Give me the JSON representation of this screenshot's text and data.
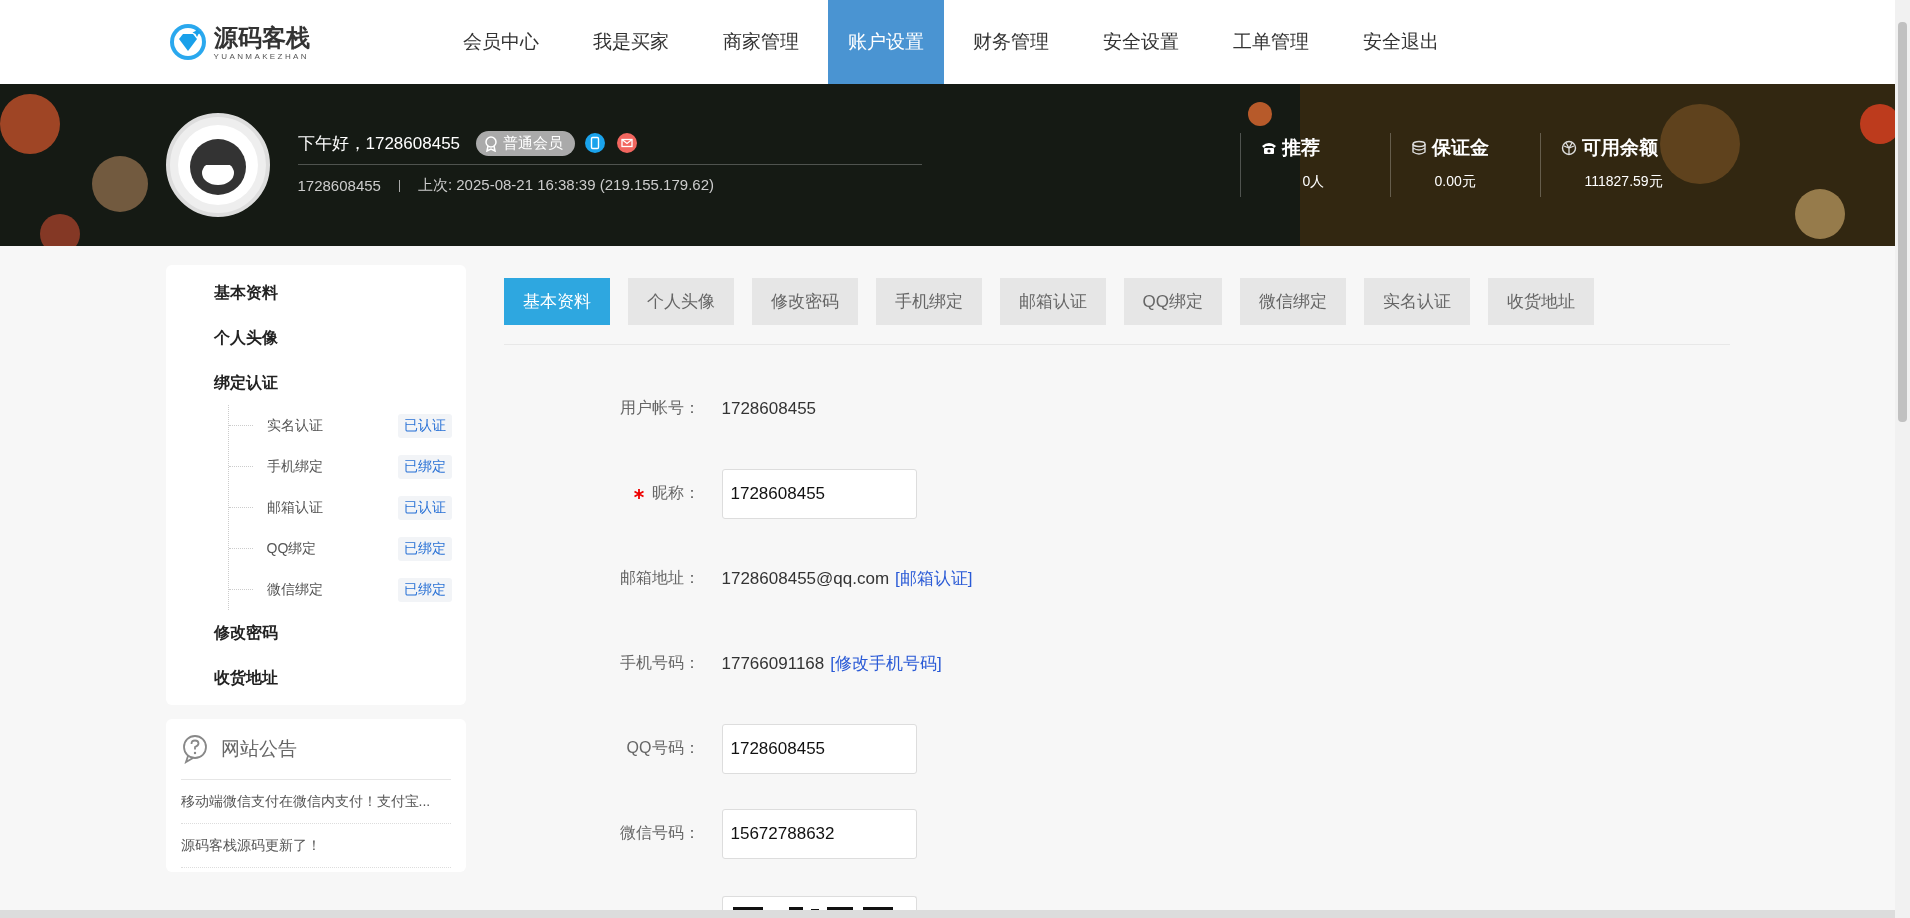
{
  "logo": {
    "title": "源码客栈",
    "subtitle": "YUANMAKEZHAN"
  },
  "nav": [
    {
      "label": "会员中心",
      "selected": false
    },
    {
      "label": "我是买家",
      "selected": false
    },
    {
      "label": "商家管理",
      "selected": false
    },
    {
      "label": "账户设置",
      "selected": true
    },
    {
      "label": "财务管理",
      "selected": false
    },
    {
      "label": "安全设置",
      "selected": false
    },
    {
      "label": "工单管理",
      "selected": false
    },
    {
      "label": "安全退出",
      "selected": false
    }
  ],
  "profile": {
    "greeting": "下午好，1728608455",
    "badge": "普通会员",
    "username": "1728608455",
    "last_login": "上次: 2025-08-21 16:38:39 (219.155.179.62)"
  },
  "stats": [
    {
      "kind": "phone",
      "label": "推荐",
      "value": "0人"
    },
    {
      "kind": "coins",
      "label": "保证金",
      "value": "0.00元"
    },
    {
      "kind": "globe",
      "label": "可用余额",
      "value": "111827.59元"
    }
  ],
  "sidebar": {
    "items": [
      {
        "label": "基本资料"
      },
      {
        "label": "个人头像"
      },
      {
        "label": "绑定认证",
        "children": [
          {
            "label": "实名认证",
            "status": "已认证"
          },
          {
            "label": "手机绑定",
            "status": "已绑定"
          },
          {
            "label": "邮箱认证",
            "status": "已认证"
          },
          {
            "label": "QQ绑定",
            "status": "已绑定"
          },
          {
            "label": "微信绑定",
            "status": "已绑定"
          }
        ]
      },
      {
        "label": "修改密码"
      },
      {
        "label": "收货地址"
      }
    ]
  },
  "notice": {
    "title": "网站公告",
    "items": [
      "移动端微信支付在微信内支付！支付宝...",
      "源码客栈源码更新了！"
    ]
  },
  "tabs": [
    {
      "label": "基本资料",
      "selected": true
    },
    {
      "label": "个人头像",
      "selected": false
    },
    {
      "label": "修改密码",
      "selected": false
    },
    {
      "label": "手机绑定",
      "selected": false
    },
    {
      "label": "邮箱认证",
      "selected": false
    },
    {
      "label": "QQ绑定",
      "selected": false
    },
    {
      "label": "微信绑定",
      "selected": false
    },
    {
      "label": "实名认证",
      "selected": false
    },
    {
      "label": "收货地址",
      "selected": false
    }
  ],
  "form": [
    {
      "kind": "text",
      "label": "用户帐号：",
      "required": false,
      "value": "1728608455"
    },
    {
      "kind": "input",
      "label": "昵称：",
      "required": true,
      "value": "1728608455"
    },
    {
      "kind": "text",
      "label": "邮箱地址：",
      "required": false,
      "value": "1728608455@qq.com",
      "link": "[邮箱认证]"
    },
    {
      "kind": "text",
      "label": "手机号码：",
      "required": false,
      "value": "17766091168",
      "link": "[修改手机号码]"
    },
    {
      "kind": "input",
      "label": "QQ号码：",
      "required": false,
      "value": "1728608455"
    },
    {
      "kind": "input",
      "label": "微信号码：",
      "required": false,
      "value": "15672788632"
    },
    {
      "kind": "qr",
      "required": false
    }
  ]
}
